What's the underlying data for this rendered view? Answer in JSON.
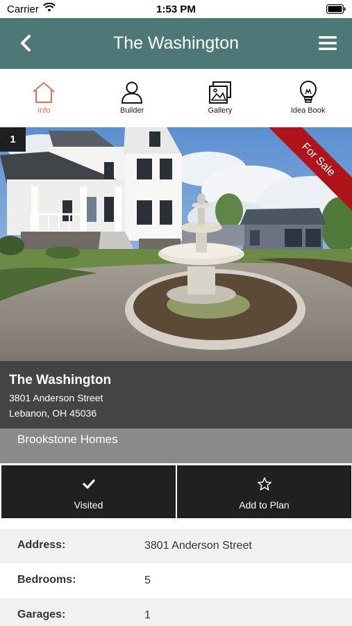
{
  "status_bar": {
    "carrier": "Carrier",
    "time": "1:53 PM"
  },
  "nav": {
    "title": "The Washington",
    "back_icon": "chevron-left-icon",
    "menu_icon": "hamburger-menu-icon"
  },
  "tabs": [
    {
      "label": "Info",
      "icon": "house-icon",
      "active": true
    },
    {
      "label": "Builder",
      "icon": "person-icon",
      "active": false
    },
    {
      "label": "Gallery",
      "icon": "gallery-icon",
      "active": false
    },
    {
      "label": "Idea Book",
      "icon": "lightbulb-icon",
      "active": false
    }
  ],
  "hero": {
    "photo_number": "1",
    "ribbon": "For Sale"
  },
  "listing": {
    "name": "The Washington",
    "address_line1": "3801 Anderson Street",
    "address_line2": "Lebanon, OH 45036",
    "builder": "Brookstone Homes"
  },
  "actions": {
    "visited_label": "Visited",
    "add_to_plan_label": "Add to Plan"
  },
  "details": [
    {
      "key": "Address:",
      "value": "3801 Anderson Street"
    },
    {
      "key": "Bedrooms:",
      "value": "5"
    },
    {
      "key": "Garages:",
      "value": "1"
    }
  ],
  "colors": {
    "nav_bg": "#4e7877",
    "accent": "#e8714f",
    "ribbon": "#b0141b",
    "button_bg": "#221f20"
  }
}
